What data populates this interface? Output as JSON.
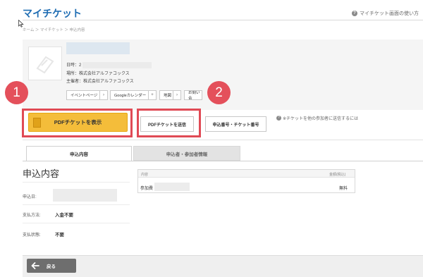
{
  "header": {
    "title": "マイチケット",
    "help_link": "マイチケット画面の使い方"
  },
  "breadcrumb": "ホーム ＞ マイチケット ＞ 申込内容",
  "ticket": {
    "date_label": "日時：2",
    "venue": "場所：株式会社アルファコックス",
    "organizer": "主催者：株式会社アルファコックス",
    "links": [
      {
        "label": "イベントページ",
        "arrow": "›"
      },
      {
        "label": "Googleカレンダー",
        "arrow": "+"
      },
      {
        "label": "地図",
        "arrow": "›"
      },
      {
        "label": "お問い合"
      }
    ]
  },
  "actions": {
    "pdf_show": "PDFチケットを表示",
    "pdf_send": "PDFチケットを送信",
    "app_number": "申込番号・チケット番号",
    "share_note": "※チケットを他の参加者に送信するには"
  },
  "callouts": [
    "1",
    "2"
  ],
  "tabs": [
    "申込内容",
    "申込者・参加者情報"
  ],
  "details": {
    "heading": "申込内容",
    "rows": [
      {
        "label": "申込日:",
        "value": ""
      },
      {
        "label": "支払方法:",
        "value": "入金不要"
      },
      {
        "label": "支払状態:",
        "value": "不要"
      }
    ]
  },
  "table": {
    "headers": [
      "内容",
      "金額(税込)"
    ],
    "rows": [
      {
        "item": "参加費",
        "amount": "無料"
      }
    ]
  },
  "footer": {
    "back_label": "戻る"
  },
  "colors": {
    "brand_blue": "#1f6db3",
    "primary_yellow": "#f4bd3a",
    "callout_red": "#e4505b"
  }
}
